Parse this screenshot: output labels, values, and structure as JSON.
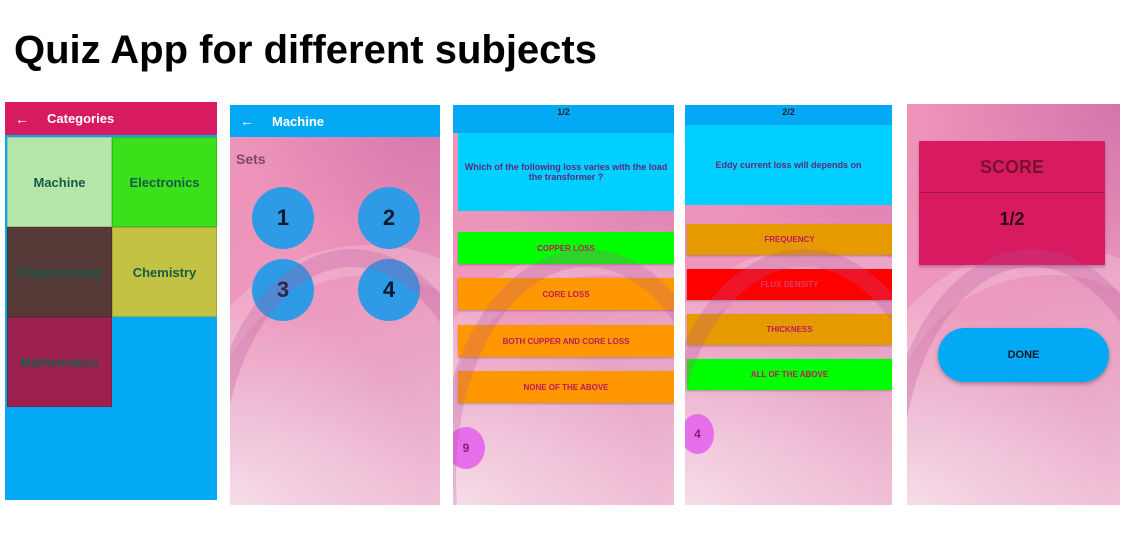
{
  "title": "Quiz App for different subjects",
  "colors": {
    "primary_pink": "#d81b60",
    "primary_blue": "#03a9f4",
    "green": "#00ff00",
    "orange": "#ff9800",
    "red": "#ff0000"
  },
  "categories_screen": {
    "back_icon": "arrow-left-icon",
    "title": "Categories",
    "items": [
      {
        "label": "Machine"
      },
      {
        "label": "Electronics"
      },
      {
        "label": "Programming"
      },
      {
        "label": "Chemistry"
      },
      {
        "label": "Mathematics"
      }
    ]
  },
  "sets_screen": {
    "back_icon": "arrow-left-icon",
    "title": "Machine",
    "sets_label": "Sets",
    "sets": [
      "1",
      "2",
      "3",
      "4"
    ]
  },
  "question_screen_1": {
    "counter": "1/2",
    "question": "Which of the following loss varies with the load the transformer ?",
    "options": [
      {
        "label": "COPPER LOSS",
        "state": "correct"
      },
      {
        "label": "CORE LOSS",
        "state": "neutral"
      },
      {
        "label": "BOTH CUPPER AND CORE LOSS",
        "state": "neutral"
      },
      {
        "label": "NONE OF THE ABOVE",
        "state": "neutral"
      }
    ],
    "timer": "9"
  },
  "question_screen_2": {
    "counter": "2/2",
    "question": "Eddy current loss will depends on",
    "options": [
      {
        "label": "FREQUENCY",
        "state": "neutral"
      },
      {
        "label": "FLUX DENSITY",
        "state": "wrong"
      },
      {
        "label": "THICKNESS",
        "state": "neutral"
      },
      {
        "label": "ALL OF THE ABOVE",
        "state": "correct"
      }
    ],
    "timer": "4"
  },
  "score_screen": {
    "score_title": "SCORE",
    "score_value": "1/2",
    "done_label": "DONE"
  }
}
